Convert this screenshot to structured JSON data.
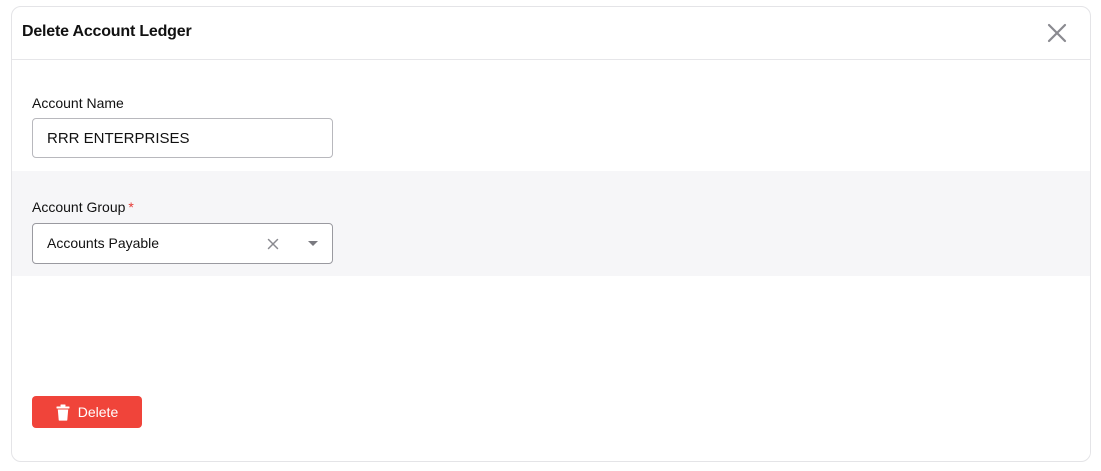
{
  "dialog": {
    "title": "Delete Account Ledger"
  },
  "fields": {
    "account_name": {
      "label": "Account Name",
      "value": "RRR ENTERPRISES"
    },
    "account_group": {
      "label": "Account Group",
      "required_marker": "*",
      "selected": "Accounts Payable"
    }
  },
  "actions": {
    "delete_label": "Delete"
  },
  "icons": {
    "close": "close-icon",
    "clear": "clear-icon",
    "dropdown": "chevron-down-icon",
    "delete": "trash-icon"
  },
  "colors": {
    "danger": "#f0443a",
    "required": "#e53935",
    "section_alt_bg": "#f6f6f8"
  }
}
